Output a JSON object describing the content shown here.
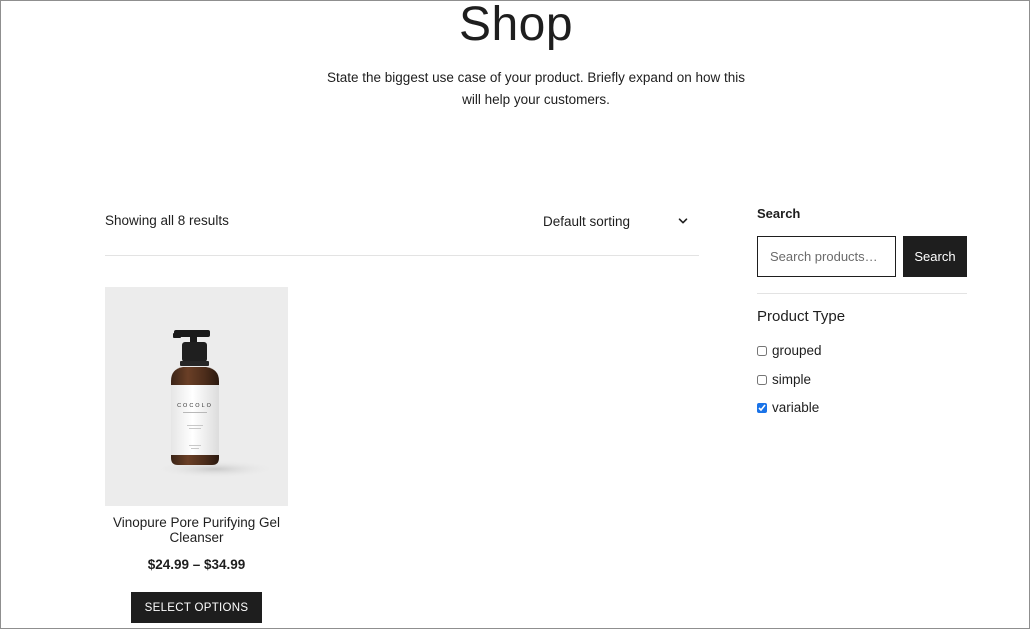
{
  "header": {
    "title": "Shop",
    "description": "State the biggest use case of your product. Briefly expand on how this will help your customers."
  },
  "toolbar": {
    "result_count": "Showing all 8 results",
    "sort_label": "Default sorting",
    "sort_icon": "chevron-down-icon"
  },
  "products": [
    {
      "name": "Vinopure Pore Purifying Gel Cleanser",
      "price": "$24.99 – $34.99",
      "button_label": "SELECT OPTIONS",
      "image_label": "COCOLO"
    }
  ],
  "sidebar": {
    "search_heading": "Search",
    "search_placeholder": "Search products…",
    "search_button": "Search",
    "product_type_heading": "Product Type",
    "filters": [
      {
        "label": "grouped",
        "checked": false
      },
      {
        "label": "simple",
        "checked": false
      },
      {
        "label": "variable",
        "checked": true
      }
    ]
  },
  "colors": {
    "text": "#1e1e1e",
    "button_bg": "#1e1e1e",
    "button_text": "#ffffff",
    "image_bg": "#ececec",
    "divider": "#e3e3e3",
    "checkbox_accent": "#1a73e8"
  }
}
